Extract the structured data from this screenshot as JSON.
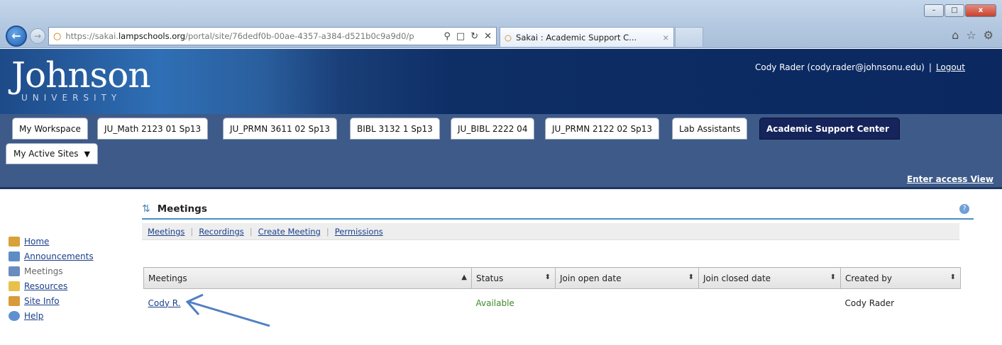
{
  "browser": {
    "window_controls": {
      "minimize": "–",
      "maximize": "□",
      "close": "x"
    },
    "url_host_prefix": "https://sakai.",
    "url_domain": "lampschools.org",
    "url_path": "/portal/site/76dedf0b-00ae-4357-a384-d521b0c9a9d0/p",
    "tab_title": "Sakai : Academic Support C...",
    "tab_close": "×",
    "icons": [
      "back-icon",
      "forward-icon",
      "search-icon",
      "lock-icon",
      "refresh-icon",
      "stop-icon",
      "home-icon",
      "favorites-icon",
      "settings-icon"
    ]
  },
  "header": {
    "logo_main": "Johnson",
    "logo_sub": "UNIVERSITY",
    "user": "Cody Rader (cody.rader@johnsonu.edu)",
    "separator": "|",
    "logout": "Logout"
  },
  "site_tabs": [
    "My Workspace",
    "JU_Math 2123 01 Sp13",
    "JU_PRMN 3611 02 Sp13",
    "BIBL 3132 1 Sp13",
    "JU_BIBL 2222 04",
    "JU_PRMN 2122 02 Sp13",
    "Lab Assistants",
    "Academic Support Center"
  ],
  "active_sites_label": "My Active Sites",
  "enter_access_view": "Enter access View",
  "tool_menu": [
    "Home",
    "Announcements",
    "Meetings",
    "Resources",
    "Site Info",
    "Help"
  ],
  "portlet": {
    "title": "Meetings",
    "toolbar": [
      "Meetings",
      "Recordings",
      "Create Meeting",
      "Permissions"
    ]
  },
  "table": {
    "columns": [
      "Meetings",
      "Status",
      "Join open date",
      "Join closed date",
      "Created by"
    ],
    "sort_icons": [
      "▲",
      "⬍",
      "⬍",
      "⬍",
      "⬍"
    ],
    "rows": [
      {
        "meeting": "Cody R.",
        "status": "Available",
        "open": "",
        "closed": "",
        "created_by": "Cody Rader"
      }
    ]
  },
  "colors": {
    "header_bg": "#0b2860",
    "nav_bg": "#3d5a89",
    "active_tab": "#15245a",
    "link": "#1a3f8a",
    "status_available": "#3f8a2a",
    "arrow": "#4f7fc2"
  }
}
